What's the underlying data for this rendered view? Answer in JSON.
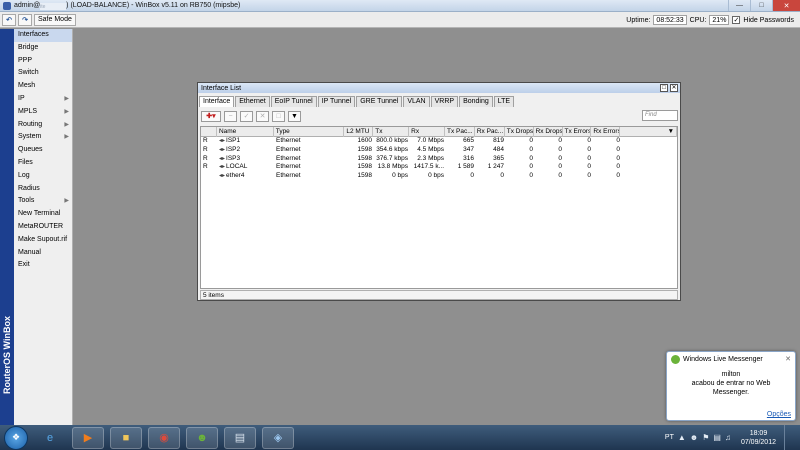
{
  "titlebar": {
    "title_prefix": "admin@",
    "title_masked": "ite",
    "title_suffix": ") (LOAD-BALANCE) - WinBox v5.11 on RB750 (mipsbe)"
  },
  "toolbar": {
    "safe_mode": "Safe Mode",
    "uptime_label": "Uptime:",
    "uptime_value": "08:52:33",
    "cpu_label": "CPU:",
    "cpu_value": "21%",
    "hide_passwords": "Hide Passwords",
    "hide_passwords_checked": true
  },
  "sidebar": {
    "brand": "RouterOS WinBox",
    "items": [
      {
        "label": "Interfaces",
        "arrow": false
      },
      {
        "label": "Bridge",
        "arrow": false
      },
      {
        "label": "PPP",
        "arrow": false
      },
      {
        "label": "Switch",
        "arrow": false
      },
      {
        "label": "Mesh",
        "arrow": false
      },
      {
        "label": "IP",
        "arrow": true
      },
      {
        "label": "MPLS",
        "arrow": true
      },
      {
        "label": "Routing",
        "arrow": true
      },
      {
        "label": "System",
        "arrow": true
      },
      {
        "label": "Queues",
        "arrow": false
      },
      {
        "label": "Files",
        "arrow": false
      },
      {
        "label": "Log",
        "arrow": false
      },
      {
        "label": "Radius",
        "arrow": false
      },
      {
        "label": "Tools",
        "arrow": true
      },
      {
        "label": "New Terminal",
        "arrow": false
      },
      {
        "label": "MetaROUTER",
        "arrow": false
      },
      {
        "label": "Make Supout.rif",
        "arrow": false
      },
      {
        "label": "Manual",
        "arrow": false
      },
      {
        "label": "Exit",
        "arrow": false
      }
    ]
  },
  "interface_list": {
    "title": "Interface List",
    "tabs": [
      "Interface",
      "Ethernet",
      "EoIP Tunnel",
      "IP Tunnel",
      "GRE Tunnel",
      "VLAN",
      "VRRP",
      "Bonding",
      "LTE"
    ],
    "find_placeholder": "Find",
    "columns": [
      "",
      "Name",
      "Type",
      "L2 MTU",
      "Tx",
      "Rx",
      "Tx Pac...",
      "Rx Pac...",
      "Tx Drops",
      "Rx Drops",
      "Tx Errors",
      "Rx Errors"
    ],
    "rows": [
      {
        "flag": "R",
        "name": "ISP1",
        "type": "Ethernet",
        "l2mtu": "1600",
        "tx": "800.0 kbps",
        "rx": "7.0 Mbps",
        "txp": "665",
        "rxp": "819",
        "txd": "0",
        "rxd": "0",
        "txe": "0",
        "rxe": "0"
      },
      {
        "flag": "R",
        "name": "ISP2",
        "type": "Ethernet",
        "l2mtu": "1598",
        "tx": "354.6 kbps",
        "rx": "4.5 Mbps",
        "txp": "347",
        "rxp": "484",
        "txd": "0",
        "rxd": "0",
        "txe": "0",
        "rxe": "0"
      },
      {
        "flag": "R",
        "name": "ISP3",
        "type": "Ethernet",
        "l2mtu": "1598",
        "tx": "376.7 kbps",
        "rx": "2.3 Mbps",
        "txp": "316",
        "rxp": "365",
        "txd": "0",
        "rxd": "0",
        "txe": "0",
        "rxe": "0"
      },
      {
        "flag": "R",
        "name": "LOCAL",
        "type": "Ethernet",
        "l2mtu": "1598",
        "tx": "13.8 Mbps",
        "rx": "1417.5 k...",
        "txp": "1 589",
        "rxp": "1 247",
        "txd": "0",
        "rxd": "0",
        "txe": "0",
        "rxe": "0"
      },
      {
        "flag": "",
        "name": "ether4",
        "type": "Ethernet",
        "l2mtu": "1598",
        "tx": "0 bps",
        "rx": "0 bps",
        "txp": "0",
        "rxp": "0",
        "txd": "0",
        "rxd": "0",
        "txe": "0",
        "rxe": "0"
      }
    ],
    "status": "5 items"
  },
  "notification": {
    "app": "Windows Live Messenger",
    "line1": "milton",
    "line2": "acabou de entrar no Web",
    "line3": "Messenger.",
    "options": "Opções"
  },
  "taskbar": {
    "lang": "PT",
    "time": "18:09",
    "date": "07/09/2012"
  },
  "colors": {
    "sidebar_strip": "#1c3f8f",
    "close_button": "#c9463d"
  }
}
